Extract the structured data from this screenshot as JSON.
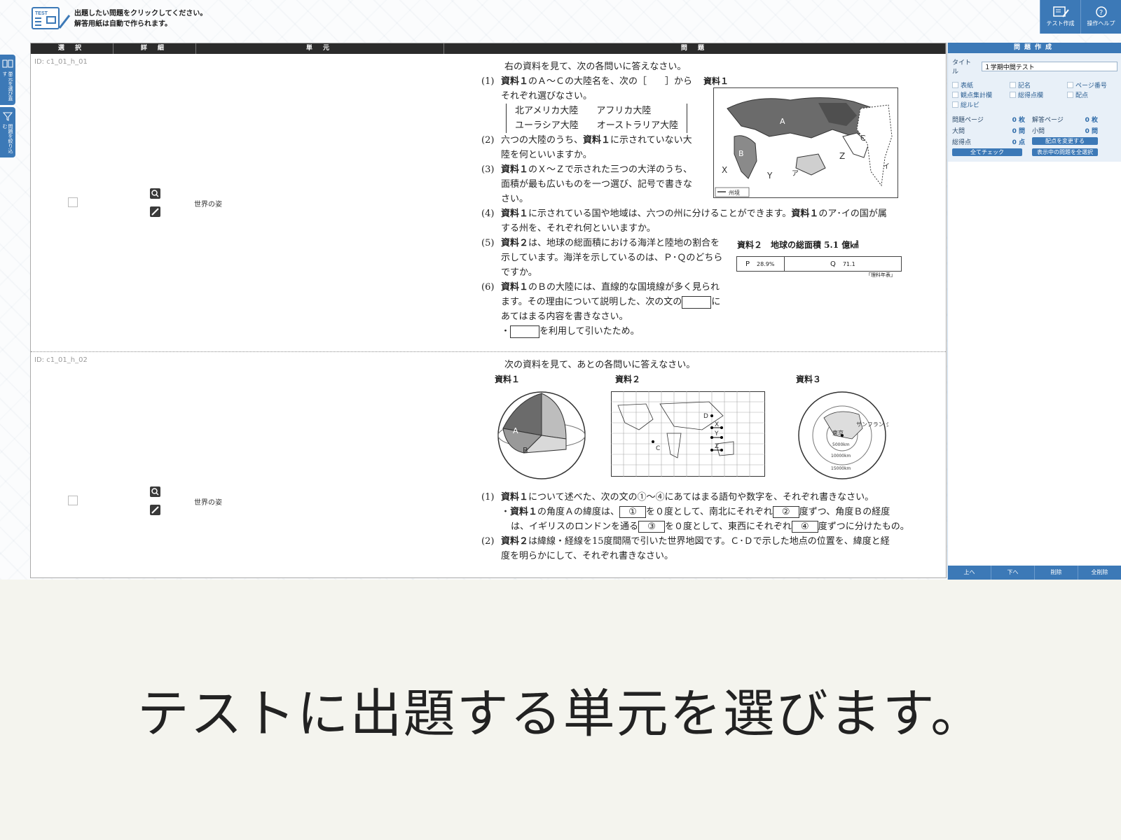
{
  "header": {
    "hint_line1": "出題したい問題をクリックしてください。",
    "hint_line2": "解答用紙は自動で作られます。",
    "buttons": [
      {
        "label": "テスト作成",
        "icon": "test-create-icon"
      },
      {
        "label": "操作ヘルプ",
        "icon": "help-icon"
      }
    ]
  },
  "left_tabs": [
    {
      "label": "単元を選び直す",
      "icon": "book-icon"
    },
    {
      "label": "問題を絞り込む",
      "icon": "filter-icon"
    }
  ],
  "columns": [
    "選 択",
    "詳 細",
    "単 元",
    "問 題"
  ],
  "rows": [
    {
      "id": "ID: c1_01_h_01",
      "unit": "世界の姿",
      "intro": "右の資料を見て、次の各問いに答えなさい。",
      "q1_num": "(1)",
      "q1_a": "資料１",
      "q1_b": "のＡ～Ｃの大陸名を、次の［　　］から",
      "q1_c": "それぞれ選びなさい。",
      "choices_row1": "北アメリカ大陸　　アフリカ大陸",
      "choices_row2": "ユーラシア大陸　　オーストラリア大陸",
      "q2_num": "(2)",
      "q2_a": "六つの大陸のうち、",
      "q2_b": "資料１",
      "q2_c": "に示されていない大",
      "q2_d": "陸を何といいますか。",
      "q3_num": "(3)",
      "q3_a": "資料１",
      "q3_b": "のＸ～Ｚで示された三つの大洋のうち、",
      "q3_c": "面積が最も広いものを一つ選び、記号で書きな",
      "q3_d": "さい。",
      "q4_num": "(4)",
      "q4_a": "資料１",
      "q4_b": "に示されている国や地域は、六つの州に分けることができます。",
      "q4_c": "資料１",
      "q4_d": "のア･イの国が属",
      "q4_e": "する州を、それぞれ何といいますか。",
      "q5_num": "(5)",
      "q5_a": "資料２",
      "q5_b": "は、地球の総面積における海洋と陸地の割合を",
      "q5_c": "示しています。海洋を示しているのは、Ｐ･Ｑのどちら",
      "q5_d": "ですか。",
      "q6_num": "(6)",
      "q6_a": "資料１",
      "q6_b": "のＢの大陸には、直線的な国境線が多く見られ",
      "q6_c": "ます。その理由について説明した、次の文の",
      "q6_d": "に",
      "q6_e": "あてはまる内容を書きなさい。",
      "q6_f": "・",
      "q6_g": "を利用して引いたため。",
      "fig1_label": "資料１",
      "fig1_legend": "州境",
      "fig2_label": "資料２　地球の総面積 5.1 億㎢",
      "fig2_p": "P",
      "fig2_p_val": "28.9%",
      "fig2_q": "Q",
      "fig2_q_val": "71.1",
      "fig2_p_frac": 0.289,
      "fig2_source": "「理科年表」",
      "map_letters": {
        "A": "A",
        "B": "B",
        "C": "C",
        "X": "X",
        "Y": "Y",
        "Z": "Z",
        "a": "ア",
        "i": "イ"
      }
    },
    {
      "id": "ID: c1_01_h_02",
      "unit": "世界の姿",
      "intro": "次の資料を見て、あとの各問いに答えなさい。",
      "fig1_label": "資料１",
      "fig2_label": "資料２",
      "fig3_label": "資料３",
      "globe_a": "A",
      "globe_b": "B",
      "grid_c": "C",
      "grid_d": "D",
      "grid_x": "X",
      "grid_y": "Y",
      "grid_z": "Z",
      "azi_tokyo": "東京",
      "azi_sf": "サンフラン シスコ",
      "azi_5000": "5000km",
      "azi_10000": "10000km",
      "azi_15000": "15000km",
      "q1_num": "(1)",
      "q1_a": "資料１",
      "q1_b": "について述べた、次の文の①～④にあてはまる語句や数字を、それぞれ書きなさい。",
      "q1_l2a": "・",
      "q1_l2b": "資料１",
      "q1_l2c": "の角度Ａの緯度は、",
      "c1": "①",
      "q1_l2d": "を０度として、南北にそれぞれ",
      "c2": "②",
      "q1_l2e": "度ずつ、角度Ｂの経度",
      "q1_l3a": "は、イギリスのロンドンを通る",
      "c3": "③",
      "q1_l3b": "を０度として、東西にそれぞれ",
      "c4": "④",
      "q1_l3c": "度ずつに分けたもの。",
      "q2_num": "(2)",
      "q2_a": "資料２",
      "q2_b": "は緯線・経線を15度間隔で引いた世界地図です。Ｃ･Ｄで示した地点の位置を、緯度と経",
      "q2_c": "度を明らかにして、それぞれ書きなさい。"
    }
  ],
  "side": {
    "header": "問題作成",
    "title_label": "タイトル",
    "title_value": "１学期中間テスト",
    "options": [
      "表紙",
      "記名",
      "ページ番号",
      "観点集計欄",
      "総得点欄",
      "配点",
      "総ルビ"
    ],
    "stats": [
      {
        "label": "問題ページ",
        "value": "0",
        "unit": "枚"
      },
      {
        "label": "解答ページ",
        "value": "0",
        "unit": "枚"
      },
      {
        "label": "大問",
        "value": "0",
        "unit": "問"
      },
      {
        "label": "小問",
        "value": "0",
        "unit": "問"
      },
      {
        "label": "総得点",
        "value": "0",
        "unit": "点"
      }
    ],
    "btn_change_points": "配点を変更する",
    "btn_check_all": "全てチェック",
    "btn_select_shown": "表示中の問題を全選択",
    "bottom_buttons": [
      "上へ",
      "下へ",
      "削除",
      "全削除"
    ]
  },
  "subtitle": "テストに出題する単元を選びます。"
}
